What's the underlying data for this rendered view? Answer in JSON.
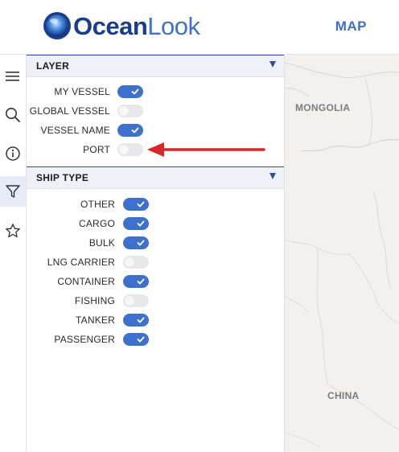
{
  "header": {
    "logo": {
      "part1": "Ocean",
      "part2": "Look"
    },
    "map_label": "MAP"
  },
  "colors": {
    "brand_dark": "#1b3c8c",
    "brand_light": "#3f72c8",
    "toggle_on": "#3e71cc",
    "annotation_arrow": "#d9252b"
  },
  "sidebar": {
    "icons": [
      "menu-icon",
      "search-icon",
      "info-icon",
      "filter-icon",
      "star-icon"
    ],
    "active": "filter-icon"
  },
  "layer": {
    "title": "LAYER",
    "items": [
      {
        "label": "MY VESSEL",
        "on": true
      },
      {
        "label": "GLOBAL VESSEL",
        "on": false
      },
      {
        "label": "VESSEL NAME",
        "on": true
      },
      {
        "label": "PORT",
        "on": false
      }
    ]
  },
  "ship_type": {
    "title": "SHIP TYPE",
    "items": [
      {
        "label": "OTHER",
        "on": true
      },
      {
        "label": "CARGO",
        "on": true
      },
      {
        "label": "BULK",
        "on": true
      },
      {
        "label": "LNG CARRIER",
        "on": false
      },
      {
        "label": "CONTAINER",
        "on": true
      },
      {
        "label": "FISHING",
        "on": false
      },
      {
        "label": "TANKER",
        "on": true
      },
      {
        "label": "PASSENGER",
        "on": true
      }
    ]
  },
  "map": {
    "labels": [
      "MONGOLIA",
      "CHINA"
    ]
  }
}
